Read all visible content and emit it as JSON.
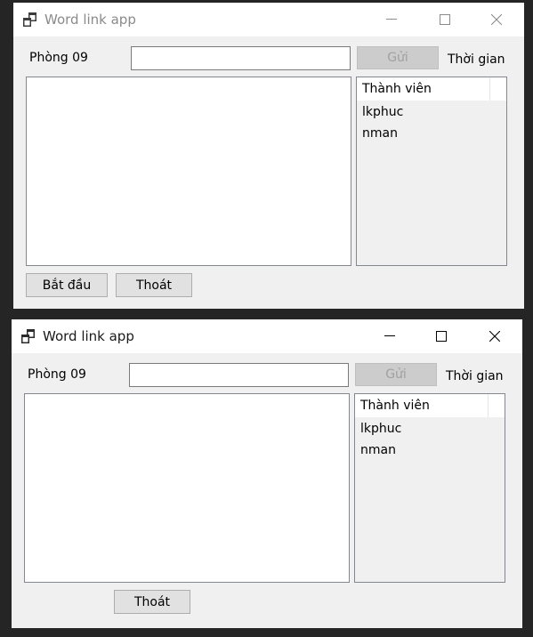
{
  "windows": [
    {
      "title": "Word link app",
      "room_label": "Phòng 09",
      "message_input": {
        "value": "",
        "placeholder": ""
      },
      "send_button": "Gửi",
      "time_label": "Thời gian",
      "members_header": "Thành viên",
      "members": [
        "lkphuc",
        "nman"
      ],
      "start_button": "Bắt đầu",
      "exit_button": "Thoát",
      "state": "inactive"
    },
    {
      "title": "Word link app",
      "room_label": "Phòng 09",
      "message_input": {
        "value": "",
        "placeholder": ""
      },
      "send_button": "Gửi",
      "time_label": "Thời gian",
      "members_header": "Thành viên",
      "members": [
        "lkphuc",
        "nman"
      ],
      "exit_button": "Thoát",
      "state": "active"
    }
  ],
  "icons": {
    "app": "app-window-icon",
    "minimize": "minimize-icon",
    "maximize": "maximize-icon",
    "close": "close-icon"
  },
  "colors": {
    "desktop_background": "#252525",
    "window_background": "#f0f0f0",
    "titlebar": "#ffffff",
    "button": "#e1e1e1",
    "disabled_button": "#cccccc"
  }
}
